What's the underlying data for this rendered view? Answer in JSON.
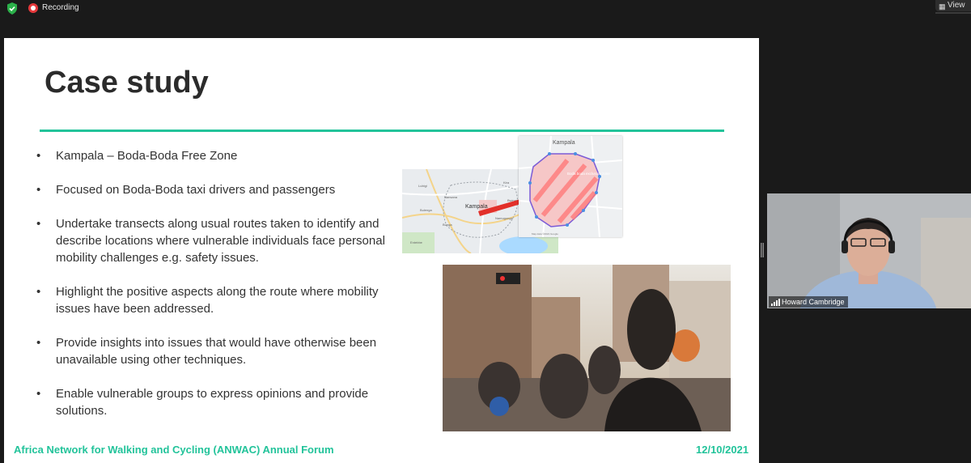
{
  "meeting": {
    "recording_label": "Recording",
    "view_label": "View",
    "view_icon": "grid-icon",
    "shield_icon": "shield-check-icon",
    "record_icon": "record-icon"
  },
  "slide": {
    "title": "Case study",
    "bullets": [
      "Kampala – Boda-Boda Free Zone",
      "Focused on Boda-Boda taxi drivers and passengers",
      "Undertake transects along usual routes taken to identify and describe locations where vulnerable individuals face personal mobility challenges e.g. safety issues.",
      "Highlight the positive aspects along the route where mobility issues have been addressed.",
      "Provide insights into issues that would have otherwise been unavailable using other techniques.",
      "Enable vulnerable groups to express opinions and provide solutions."
    ],
    "footer_left": "Africa Network for Walking and Cycling (ANWAC)  Annual Forum",
    "footer_right": "12/10/2021",
    "accent_color": "#22c39a",
    "map_overview": {
      "city_label": "Kampala",
      "places": [
        "Lubigi",
        "Nansana",
        "Bweyogerere",
        "Kira",
        "Mukono",
        "Bulenga",
        "Bunga",
        "Namugongo",
        "Entebbe"
      ],
      "credit": ""
    },
    "map_zoom": {
      "city_label": "Kampala",
      "zone_label": "Boda boda exclusion zone",
      "credit": "Map data ©2021 Google"
    }
  },
  "participant": {
    "name": "Howard Cambridge",
    "signal_icon": "signal-strength-icon"
  }
}
